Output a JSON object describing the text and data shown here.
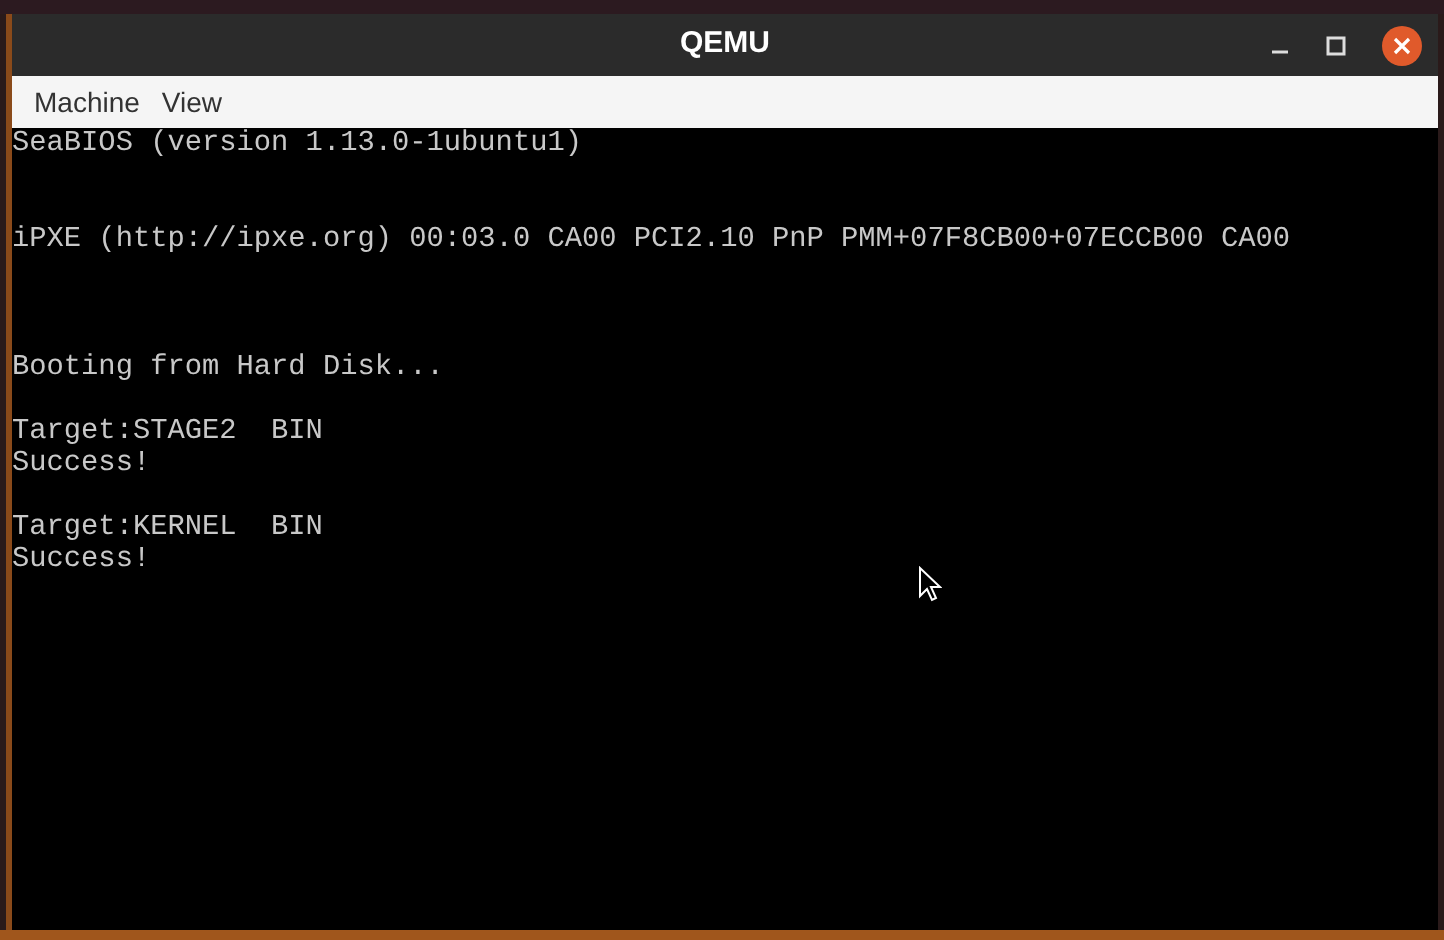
{
  "window": {
    "title": "QEMU"
  },
  "menu": [
    {
      "label": "Machine"
    },
    {
      "label": "View"
    }
  ],
  "console": {
    "text": "SeaBIOS (version 1.13.0-1ubuntu1)\n\n\niPXE (http://ipxe.org) 00:03.0 CA00 PCI2.10 PnP PMM+07F8CB00+07ECCB00 CA00\n\n\n\nBooting from Hard Disk...\n\nTarget:STAGE2  BIN\nSuccess!\n\nTarget:KERNEL  BIN\nSuccess!"
  }
}
